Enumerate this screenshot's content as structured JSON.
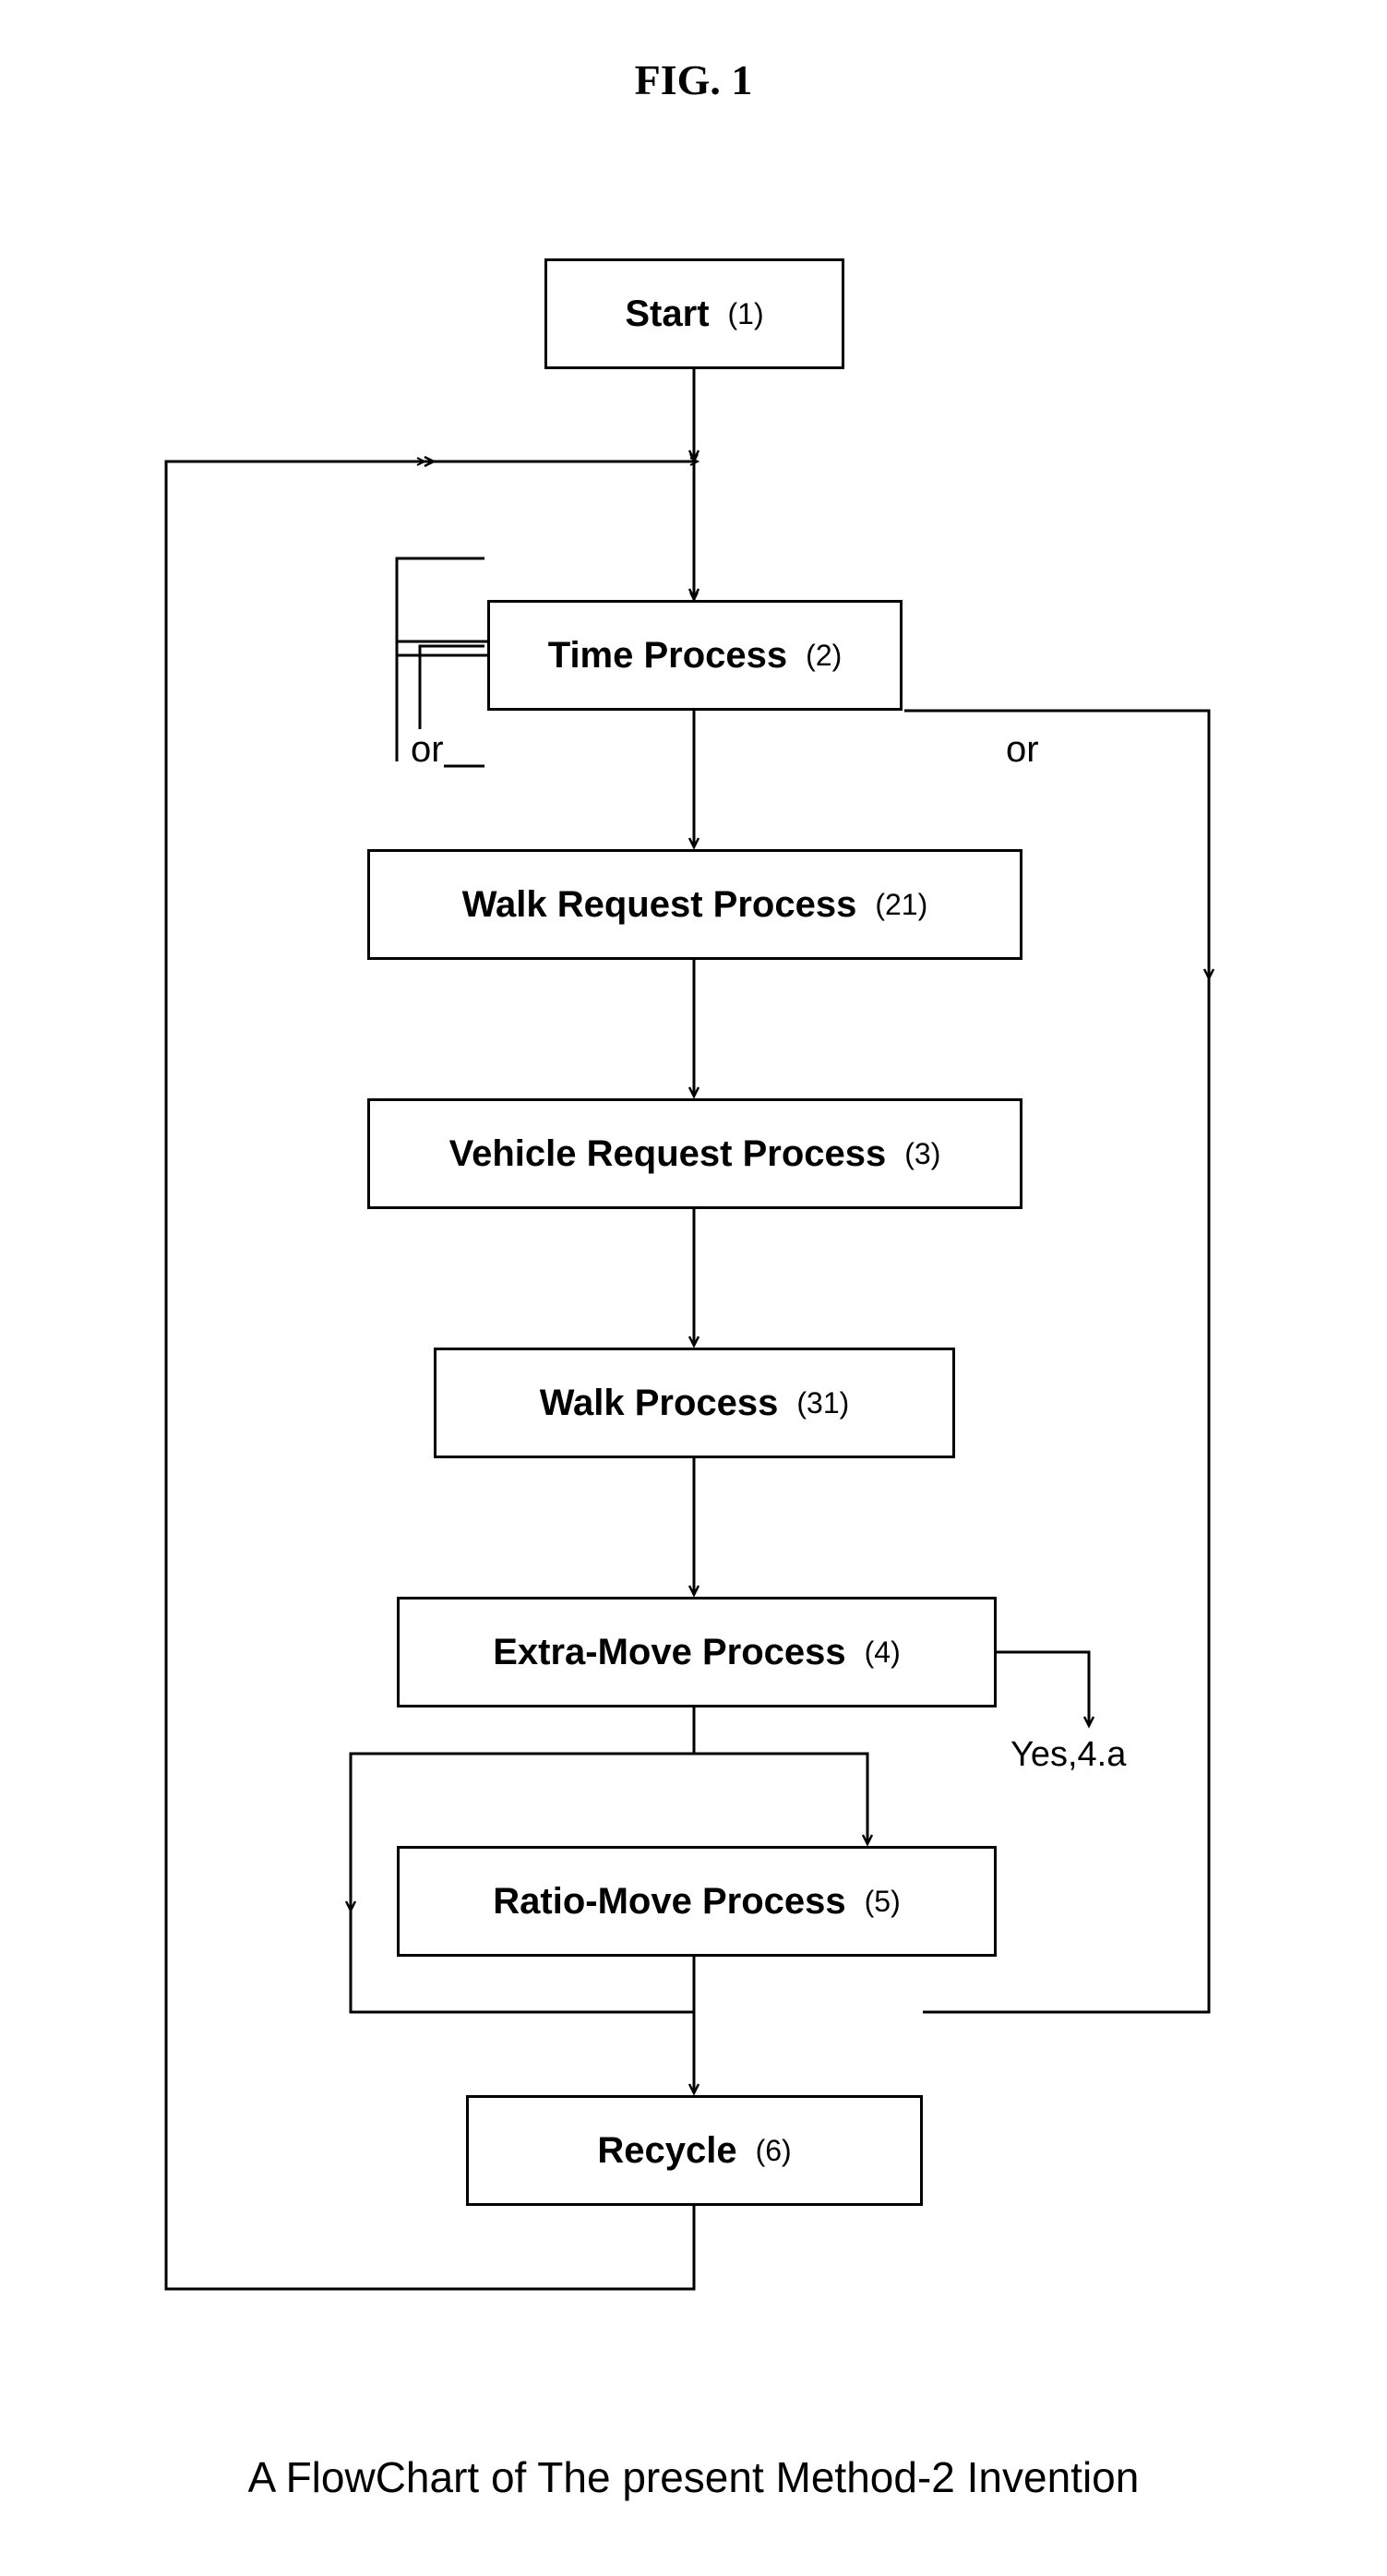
{
  "figure_title": "FIG. 1",
  "caption": "A FlowChart of The present Method-2 Invention",
  "nodes": {
    "start": {
      "label": "Start",
      "ref": "(1)"
    },
    "time_process": {
      "label": "Time Process",
      "ref": "(2)"
    },
    "walk_request": {
      "label": "Walk Request Process",
      "ref": "(21)"
    },
    "vehicle_request": {
      "label": "Vehicle Request Process",
      "ref": "(3)"
    },
    "walk_process": {
      "label": "Walk Process",
      "ref": "(31)"
    },
    "extra_move": {
      "label": "Extra-Move Process",
      "ref": "(4)"
    },
    "ratio_move": {
      "label": "Ratio-Move Process",
      "ref": "(5)"
    },
    "recycle": {
      "label": "Recycle",
      "ref": "(6)"
    }
  },
  "edge_labels": {
    "left_or": "or",
    "right_or": "or",
    "yes_4a": "Yes,4.a"
  }
}
